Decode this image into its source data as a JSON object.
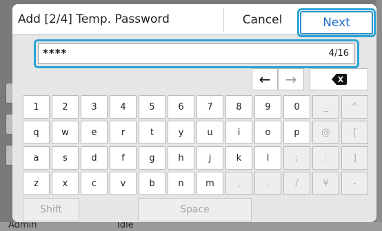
{
  "background": {
    "status_user": "Admin",
    "status_state": "Idle"
  },
  "dialog": {
    "title": "Add [2/4] Temp. Password",
    "cancel_label": "Cancel",
    "next_label": "Next"
  },
  "input": {
    "value": "****",
    "count": "4/16"
  },
  "keyboard": {
    "rows": [
      [
        {
          "label": "1",
          "enabled": true
        },
        {
          "label": "2",
          "enabled": true
        },
        {
          "label": "3",
          "enabled": true
        },
        {
          "label": "4",
          "enabled": true
        },
        {
          "label": "5",
          "enabled": true
        },
        {
          "label": "6",
          "enabled": true
        },
        {
          "label": "7",
          "enabled": true
        },
        {
          "label": "8",
          "enabled": true
        },
        {
          "label": "9",
          "enabled": true
        },
        {
          "label": "0",
          "enabled": true
        },
        {
          "label": "_",
          "enabled": false
        },
        {
          "label": "^",
          "enabled": false
        }
      ],
      [
        {
          "label": "q",
          "enabled": true
        },
        {
          "label": "w",
          "enabled": true
        },
        {
          "label": "e",
          "enabled": true
        },
        {
          "label": "r",
          "enabled": true
        },
        {
          "label": "t",
          "enabled": true
        },
        {
          "label": "y",
          "enabled": true
        },
        {
          "label": "u",
          "enabled": true
        },
        {
          "label": "i",
          "enabled": true
        },
        {
          "label": "o",
          "enabled": true
        },
        {
          "label": "p",
          "enabled": true
        },
        {
          "label": "@",
          "enabled": false
        },
        {
          "label": "[",
          "enabled": false
        }
      ],
      [
        {
          "label": "a",
          "enabled": true
        },
        {
          "label": "s",
          "enabled": true
        },
        {
          "label": "d",
          "enabled": true
        },
        {
          "label": "f",
          "enabled": true
        },
        {
          "label": "g",
          "enabled": true
        },
        {
          "label": "h",
          "enabled": true
        },
        {
          "label": "j",
          "enabled": true
        },
        {
          "label": "k",
          "enabled": true
        },
        {
          "label": "l",
          "enabled": true
        },
        {
          "label": ";",
          "enabled": false
        },
        {
          "label": ":",
          "enabled": false
        },
        {
          "label": "]",
          "enabled": false
        }
      ],
      [
        {
          "label": "z",
          "enabled": true
        },
        {
          "label": "x",
          "enabled": true
        },
        {
          "label": "c",
          "enabled": true
        },
        {
          "label": "v",
          "enabled": true
        },
        {
          "label": "b",
          "enabled": true
        },
        {
          "label": "n",
          "enabled": true
        },
        {
          "label": "m",
          "enabled": true
        },
        {
          "label": ",",
          "enabled": false
        },
        {
          "label": ".",
          "enabled": false
        },
        {
          "label": "/",
          "enabled": false
        },
        {
          "label": "¥",
          "enabled": false
        },
        {
          "label": "-",
          "enabled": false
        }
      ]
    ],
    "shift_label": "Shift",
    "space_label": "Space"
  },
  "icons": {
    "cursor_left": "arrow-left-icon",
    "cursor_right": "arrow-right-icon",
    "backspace": "backspace-icon"
  },
  "colors": {
    "highlight": "#2aa3d6",
    "next_text": "#1f6fd0"
  }
}
